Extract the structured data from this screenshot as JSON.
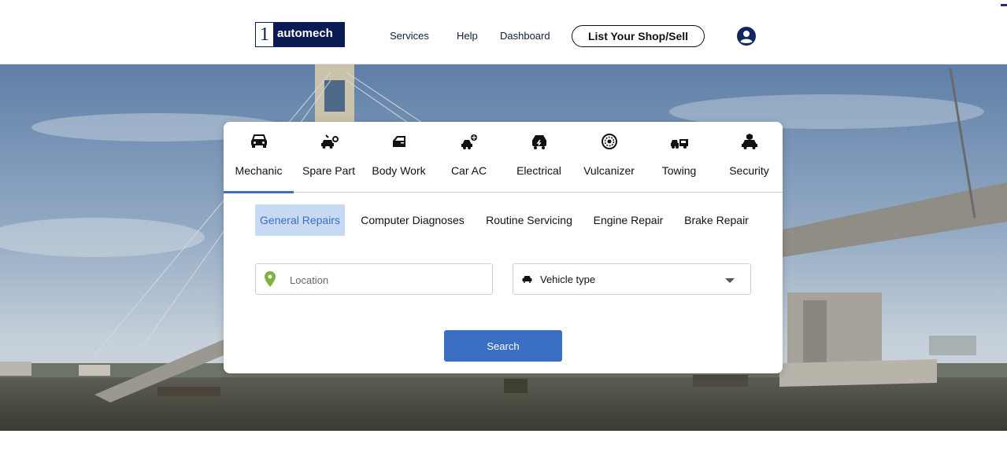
{
  "brand": {
    "logo_number": "1",
    "logo_text": "automech",
    "primary_color": "#0a1a52",
    "accent_color": "#3a6fc4"
  },
  "nav": {
    "links": [
      {
        "label": "Services"
      },
      {
        "label": "Help"
      },
      {
        "label": "Dashboard"
      }
    ],
    "cta_label": "List Your Shop/Sell",
    "user_icon": "user-circle-icon"
  },
  "categories": [
    {
      "label": "Mechanic",
      "icon": "car-front-icon",
      "active": true
    },
    {
      "label": "Spare Part",
      "icon": "spare-part-icon",
      "active": false
    },
    {
      "label": "Body Work",
      "icon": "car-door-icon",
      "active": false
    },
    {
      "label": "Car AC",
      "icon": "car-ac-icon",
      "active": false
    },
    {
      "label": "Electrical",
      "icon": "electrical-icon",
      "active": false
    },
    {
      "label": "Vulcanizer",
      "icon": "tire-icon",
      "active": false
    },
    {
      "label": "Towing",
      "icon": "tow-truck-icon",
      "active": false
    },
    {
      "label": "Security",
      "icon": "car-security-icon",
      "active": false
    }
  ],
  "services": [
    {
      "label": "General Repairs",
      "active": true
    },
    {
      "label": "Computer Diagnoses",
      "active": false
    },
    {
      "label": "Routine Servicing",
      "active": false
    },
    {
      "label": "Engine Repair",
      "active": false
    },
    {
      "label": "Brake Repair",
      "active": false
    }
  ],
  "search": {
    "location_placeholder": "Location",
    "vehicle_type_value": "Vehicle type",
    "button_label": "Search"
  }
}
